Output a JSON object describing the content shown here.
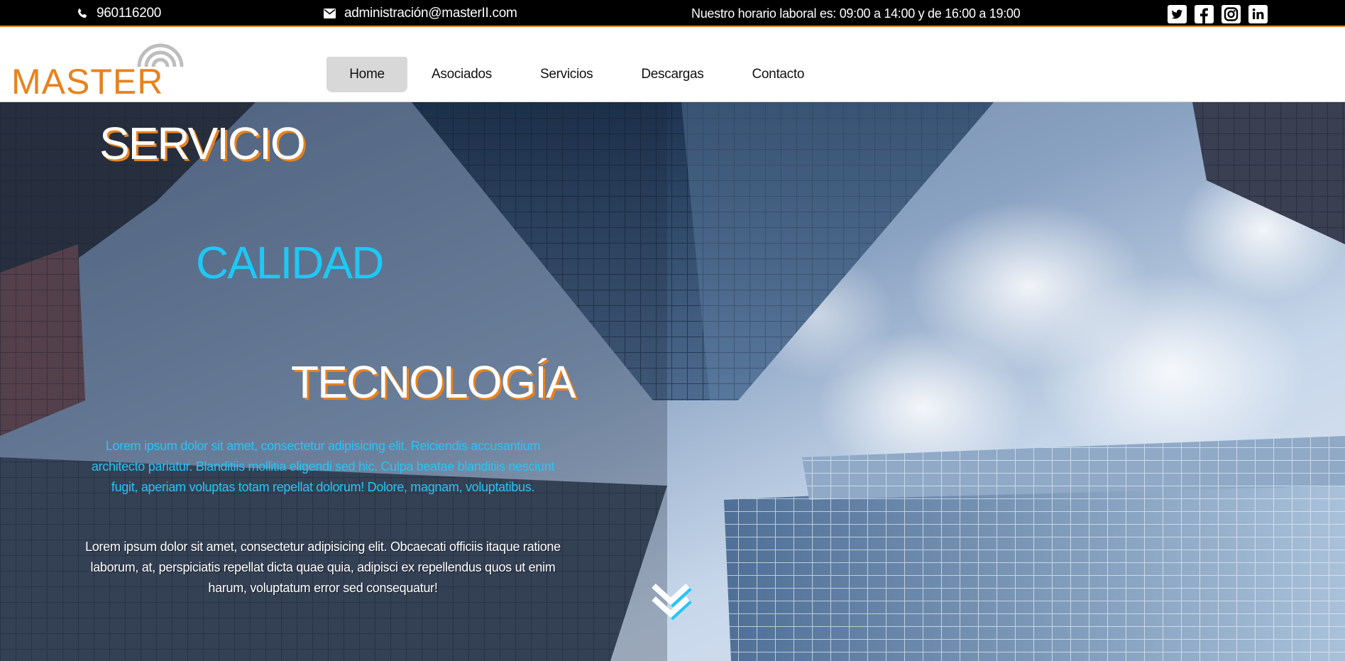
{
  "topbar": {
    "phone": "960116200",
    "email": "administración@masterII.com",
    "hours": "Nuestro horario laboral es: 09:00 a 14:00 y de 16:00 a 19:00",
    "social": [
      "twitter-icon",
      "facebook-icon",
      "instagram-icon",
      "linkedin-icon"
    ]
  },
  "header": {
    "logo_text": "MASTER II",
    "nav": [
      "Home",
      "Asociados",
      "Servicios",
      "Descargas",
      "Contacto"
    ],
    "active_nav": "Home"
  },
  "hero": {
    "word1": "SERVICIO",
    "word2": "CALIDAD",
    "word3": "TECNOLOGÍA",
    "paragraph_blue": "Lorem ipsum dolor sit amet, consectetur adipisicing elit. Reiciendis accusantium architecto pariatur. Blanditiis mollitia eligendi sed hic. Culpa beatae blanditiis nesciunt fugit, aperiam voluptas totam repellat dolorum! Dolore, magnam, voluptatibus.",
    "paragraph_white": "Lorem ipsum dolor sit amet, consectetur adipisicing elit. Obcaecati officiis itaque ratione laborum, at, perspiciatis repellat dicta quae quia, adipisci ex repellendus quos ut enim harum, voluptatum error sed consequatur!",
    "scroll_icon": "double-chevron-down-icon"
  },
  "colors": {
    "accent": "#e8821e",
    "cyan": "#1ec8f5",
    "topbar_bg": "#000000",
    "nav_active_bg": "#d8d8d8"
  }
}
